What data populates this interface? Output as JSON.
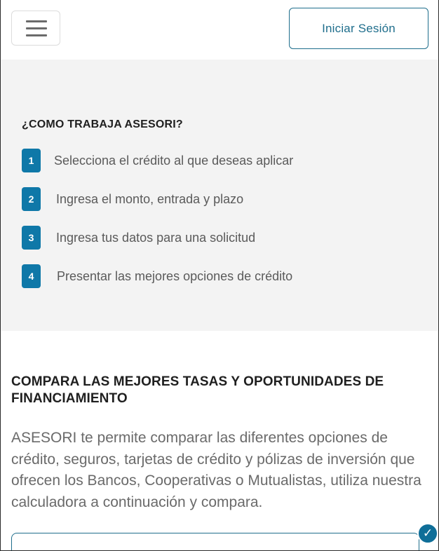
{
  "header": {
    "menu_icon": "hamburger-menu-icon",
    "login_label": "Iniciar Sesión"
  },
  "how_it_works": {
    "title": "¿COMO TRABAJA ASESORI?",
    "steps": [
      {
        "number": "1",
        "text": "Selecciona el crédito al que deseas aplicar"
      },
      {
        "number": "2",
        "text": "Ingresa el monto, entrada y plazo"
      },
      {
        "number": "3",
        "text": "Ingresa tus datos para una solicitud"
      },
      {
        "number": "4",
        "text": "Presentar las mejores opciones de crédito"
      }
    ]
  },
  "compare": {
    "title": "COMPARA LAS MEJORES TASAS Y OPORTUNIDADES DE FINANCIAMIENTO",
    "body": "ASESORI te permite comparar las diferentes opciones de crédito, seguros, tarjetas de crédito y pólizas de inversión que ofrecen los Bancos, Cooperativas o Mutualistas, utiliza nuestra calculadora a continuación y compara."
  },
  "calculator": {
    "badge_icon": "checkmark-icon",
    "badge_glyph": "✓"
  },
  "colors": {
    "accent": "#0f78a8",
    "border_accent": "#1f6e8c",
    "section_bg": "#f3f3f3"
  }
}
